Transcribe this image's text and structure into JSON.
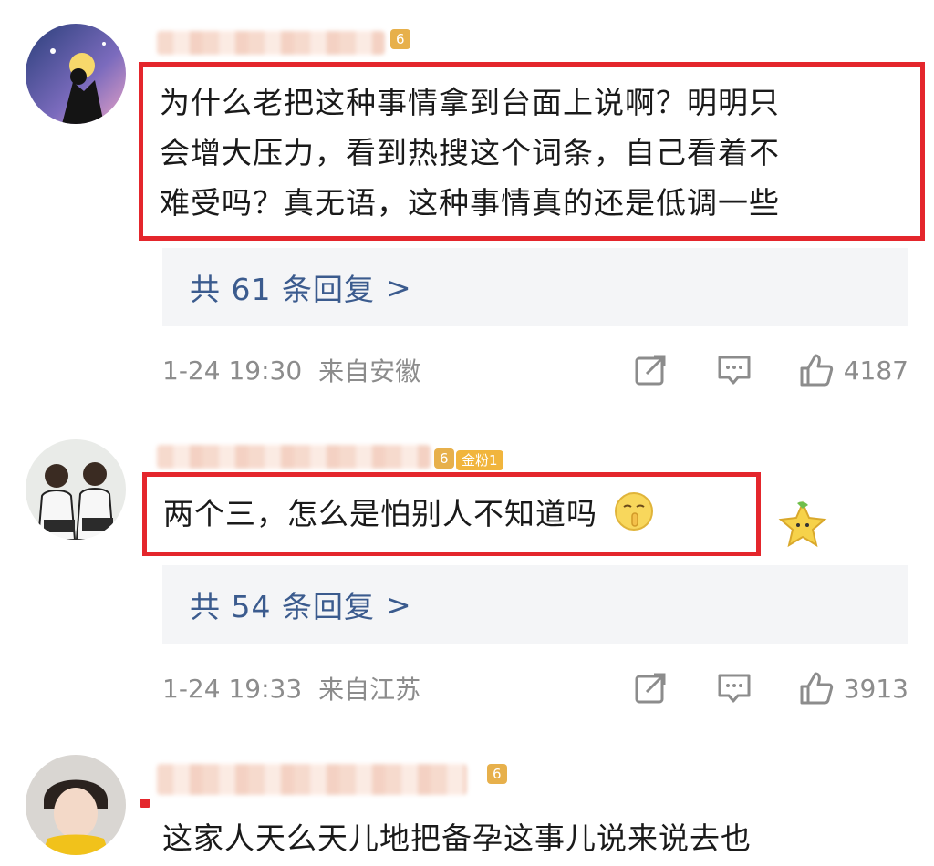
{
  "comments": [
    {
      "badge_level": "6",
      "text_lines": [
        "为什么老把这种事情拿到台面上说啊？明明只",
        "会增大压力，看到热搜这个词条，自己看着不",
        "难受吗？真无语，这种事情真的还是低调一些"
      ],
      "reply_label": "共 61 条回复",
      "reply_arrow": ">",
      "time": "1-24 19:30",
      "location": "来自安徽",
      "likes": "4187"
    },
    {
      "badge_level": "6",
      "fan_badge": "金粉1",
      "text": "两个三，怎么是怕别人不知道吗",
      "reply_label": "共 54 条回复",
      "reply_arrow": ">",
      "time": "1-24 19:33",
      "location": "来自江苏",
      "likes": "3913"
    },
    {
      "badge_level": "6",
      "text": "这家人天么天儿地把备孕这事儿说来说去也"
    }
  ],
  "colors": {
    "highlight_border": "#e4262c",
    "link": "#3b5b8e",
    "meta": "#8c8c8c",
    "reply_bg": "#f4f5f7"
  }
}
